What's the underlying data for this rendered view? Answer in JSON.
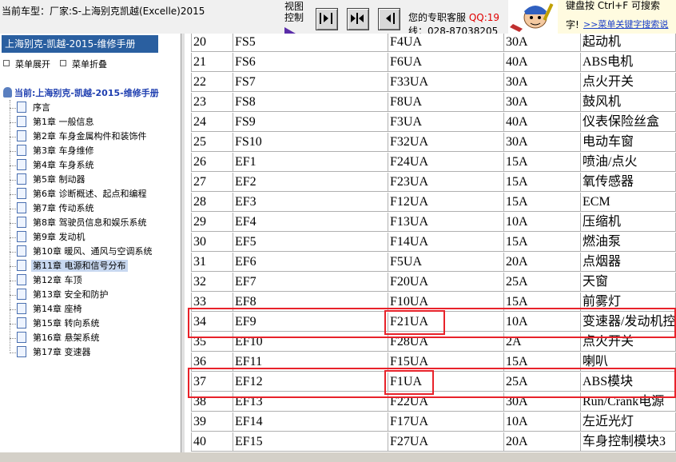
{
  "topbar": {
    "title": "当前车型：厂家:S-上海别克凯越(Excelle)2015",
    "view_control": "视图控制",
    "service": "您的专职客服",
    "qq": "QQ:19",
    "phone": "线：028-87038205",
    "tip_line1": "键盘按 Ctrl+F 可搜索",
    "tip_line2": "字!",
    "tip_link": ">>菜单关键字搜索说"
  },
  "sidebar": {
    "header": "上海别克-凯越-2015-维修手册",
    "expand": "菜单展开",
    "collapse": "菜单折叠",
    "root": "当前:上海别克-凯越-2015-维修手册",
    "items": [
      {
        "label": "序言"
      },
      {
        "label": "第1章 一般信息"
      },
      {
        "label": "第2章 车身金属构件和装饰件"
      },
      {
        "label": "第3章 车身维修"
      },
      {
        "label": "第4章 车身系统"
      },
      {
        "label": "第5章 制动器"
      },
      {
        "label": "第6章 诊断概述、起点和编程"
      },
      {
        "label": "第7章 传动系统"
      },
      {
        "label": "第8章 驾驶员信息和娱乐系统"
      },
      {
        "label": "第9章 发动机"
      },
      {
        "label": "第10章 暖风、通风与空调系统"
      },
      {
        "label": "第11章 电源和信号分布"
      },
      {
        "label": "第12章 车顶"
      },
      {
        "label": "第13章 安全和防护"
      },
      {
        "label": "第14章 座椅"
      },
      {
        "label": "第15章 转向系统"
      },
      {
        "label": "第16章 悬架系统"
      },
      {
        "label": "第17章 变速器"
      }
    ],
    "selected_index": 11
  },
  "fuse_table": {
    "rows": [
      [
        "20",
        "FS5",
        "F4UA",
        "30A",
        "起动机"
      ],
      [
        "21",
        "FS6",
        "F6UA",
        "40A",
        "ABS电机"
      ],
      [
        "22",
        "FS7",
        "F33UA",
        "30A",
        "点火开关"
      ],
      [
        "23",
        "FS8",
        "F8UA",
        "30A",
        "鼓风机"
      ],
      [
        "24",
        "FS9",
        "F3UA",
        "40A",
        "仪表保险丝盒"
      ],
      [
        "25",
        "FS10",
        "F32UA",
        "30A",
        "电动车窗"
      ],
      [
        "26",
        "EF1",
        "F24UA",
        "15A",
        "喷油/点火"
      ],
      [
        "27",
        "EF2",
        "F23UA",
        "15A",
        "氧传感器"
      ],
      [
        "28",
        "EF3",
        "F12UA",
        "15A",
        "ECM"
      ],
      [
        "29",
        "EF4",
        "F13UA",
        "10A",
        "压缩机"
      ],
      [
        "30",
        "EF5",
        "F14UA",
        "15A",
        "燃油泵"
      ],
      [
        "31",
        "EF6",
        "F5UA",
        "20A",
        "点烟器"
      ],
      [
        "32",
        "EF7",
        "F20UA",
        "25A",
        "天窗"
      ],
      [
        "33",
        "EF8",
        "F10UA",
        "15A",
        "前雾灯"
      ],
      [
        "34",
        "EF9",
        "F21UA",
        "10A",
        "变速器/发动机控"
      ],
      [
        "35",
        "EF10",
        "F28UA",
        "2A",
        "点火开关"
      ],
      [
        "36",
        "EF11",
        "F15UA",
        "15A",
        "喇叭"
      ],
      [
        "37",
        "EF12",
        "F1UA",
        "25A",
        "ABS模块"
      ],
      [
        "38",
        "EF13",
        "F22UA",
        "30A",
        "Run/Crank电源"
      ],
      [
        "39",
        "EF14",
        "F17UA",
        "10A",
        "左近光灯"
      ],
      [
        "40",
        "EF15",
        "F27UA",
        "20A",
        "车身控制模块3"
      ]
    ],
    "highlighted_rows": [
      14,
      17
    ],
    "highlight_color": "#e8222a"
  }
}
